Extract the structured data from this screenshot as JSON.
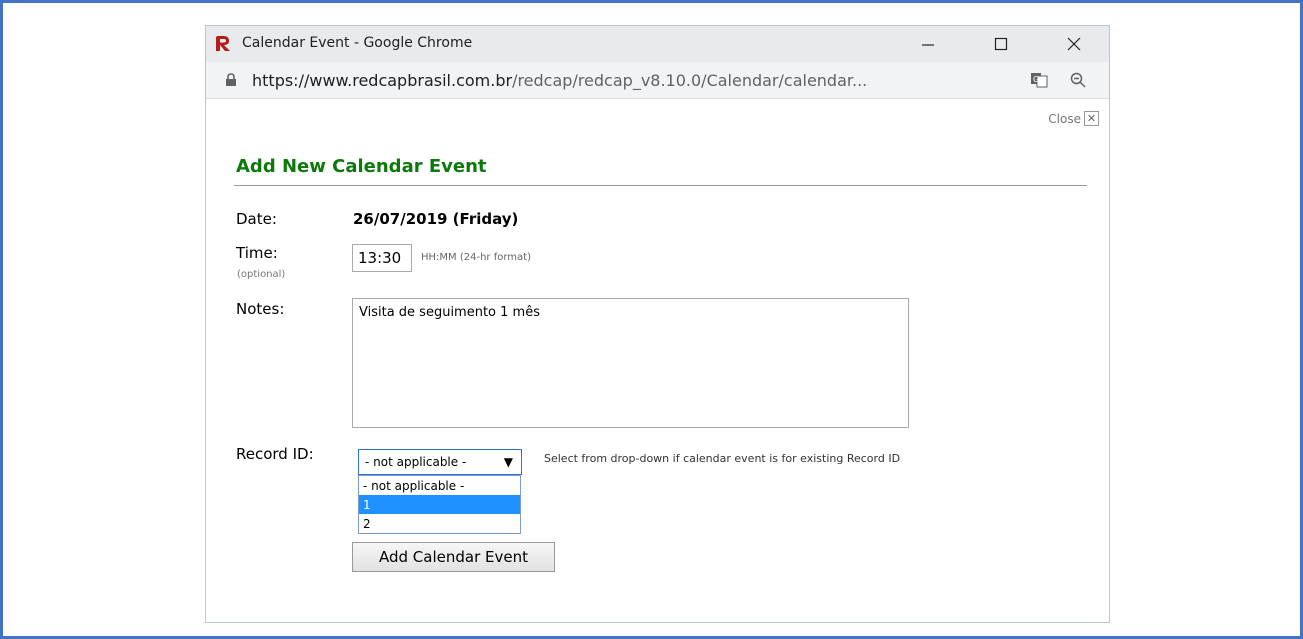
{
  "window": {
    "title": "Calendar Event - Google Chrome",
    "url_host": "https://www.redcapbrasil.com.br",
    "url_path": "/redcap/redcap_v8.10.0/Calendar/calendar..."
  },
  "dialog": {
    "close_label": "Close",
    "heading": "Add New Calendar Event",
    "date_label": "Date:",
    "date_value": "26/07/2019 (Friday)",
    "time_label": "Time:",
    "time_optional": "(optional)",
    "time_value": "13:30",
    "time_help": "HH:MM (24-hr format)",
    "notes_label": "Notes:",
    "notes_value": "Visita de seguimento 1 mês",
    "record_label": "Record ID:",
    "record_selected": "- not applicable -",
    "record_help": "Select from drop-down if calendar event is for existing Record ID",
    "record_options": [
      "- not applicable -",
      "1",
      "2"
    ],
    "submit_label": "Add Calendar Event"
  },
  "colors": {
    "heading": "#0b7a0b",
    "highlight": "#1e90ff",
    "frame": "#4472c4"
  }
}
